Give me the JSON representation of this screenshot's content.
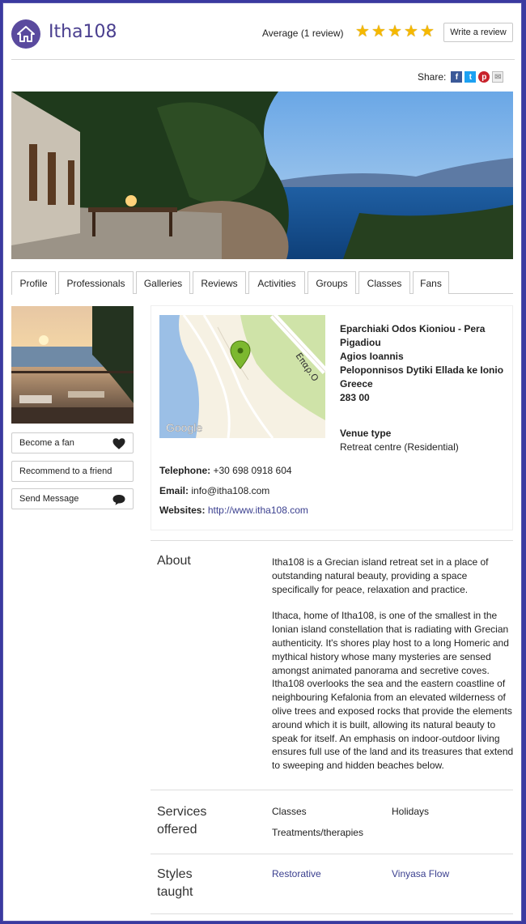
{
  "header": {
    "title": "Itha108",
    "rating_label": "Average (1 review)",
    "rating_value": 5,
    "rating_max": 5,
    "write_review": "Write a review"
  },
  "share": {
    "label": "Share:",
    "icons": [
      "facebook-icon",
      "twitter-icon",
      "pinterest-icon",
      "email-icon"
    ]
  },
  "tabs": [
    {
      "label": "Profile",
      "active": true
    },
    {
      "label": "Professionals"
    },
    {
      "label": "Galleries"
    },
    {
      "label": "Reviews"
    },
    {
      "label": "Activities"
    },
    {
      "label": "Groups"
    },
    {
      "label": "Classes"
    },
    {
      "label": "Fans"
    }
  ],
  "sidebar": {
    "buttons": [
      {
        "label": "Become a fan",
        "icon": "heart-icon"
      },
      {
        "label": "Recommend to a friend"
      },
      {
        "label": "Send Message",
        "icon": "speech-bubble-icon"
      }
    ]
  },
  "map": {
    "road_label": "Επαρ.Ο",
    "brand": "Google"
  },
  "address": {
    "lines": [
      "Eparchiaki Odos Kioniou - Pera Pigadiou",
      "Agios Ioannis",
      "Peloponnisos Dytiki Ellada ke Ionio",
      "Greece",
      "283 00"
    ],
    "venue_type_label": "Venue type",
    "venue_type_value": "Retreat centre (Residential)"
  },
  "contact": {
    "telephone_label": "Telephone:",
    "telephone": "+30 698 0918 604",
    "email_label": "Email:",
    "email": "info@itha108.com",
    "websites_label": "Websites:",
    "website": "http://www.itha108.com"
  },
  "about": {
    "heading": "About",
    "paragraphs": [
      "Itha108 is a Grecian island retreat set in a place of outstanding natural beauty, providing a space specifically for peace, relaxation and practice.",
      "Ithaca, home of Itha108, is one of the smallest in the Ionian island constellation that is radiating with Grecian authenticity. It's shores play host to a long Homeric and mythical history whose many mysteries are sensed amongst animated panorama and secretive coves. Itha108 overlooks the sea and the eastern coastline of neighbouring Kefalonia from an elevated wilderness of olive trees and exposed rocks that provide the elements around which it is built, allowing its natural beauty to speak for itself. An emphasis on indoor-outdoor living ensures full use of the land and its treasures that extend to sweeping and hidden beaches below."
    ]
  },
  "services": {
    "heading_line1": "Services",
    "heading_line2": "offered",
    "items": [
      "Classes",
      "Holidays",
      "Treatments/therapies"
    ]
  },
  "styles": {
    "heading_line1": "Styles",
    "heading_line2": "taught",
    "items": [
      "Restorative",
      "Vinyasa Flow"
    ]
  },
  "colors": {
    "brand": "#4a3f8f",
    "link": "#3a3f8f",
    "star": "#f5b800",
    "page_border": "#3b3aa0"
  }
}
